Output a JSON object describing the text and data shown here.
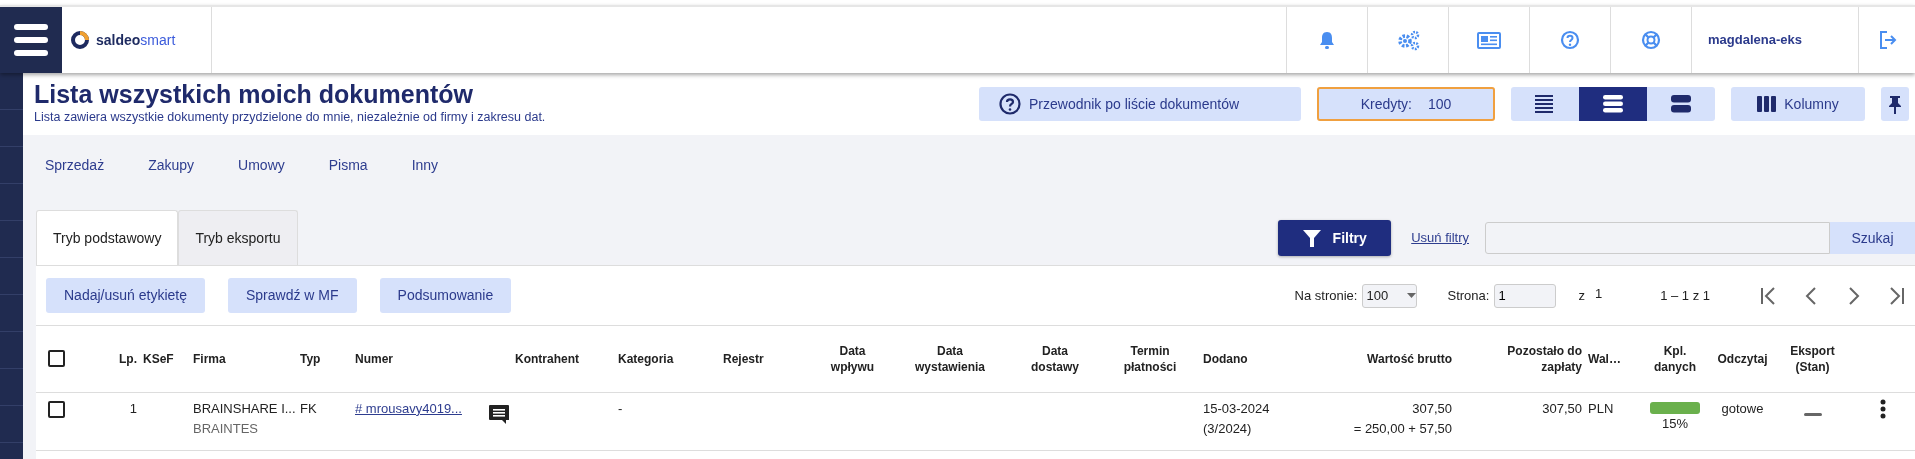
{
  "header": {
    "logo": {
      "part_a": "saldeo",
      "part_b": "smart"
    },
    "username": "magdalena-eks"
  },
  "page": {
    "title": "Lista wszystkich moich dokumentów",
    "subtitle": "Lista zawiera wszystkie dokumenty przydzielone do mnie, niezależnie od firmy i zakresu dat."
  },
  "toolbar": {
    "guide_button": "Przewodnik po liście dokumentów",
    "credits": {
      "label": "Kredyty:",
      "value": "100"
    },
    "view_modes": [
      {
        "kind": "compact",
        "selected": false
      },
      {
        "kind": "normal",
        "selected": true
      },
      {
        "kind": "wide",
        "selected": false
      }
    ],
    "columns_button": "Kolumny"
  },
  "categories": [
    "Sprzedaż",
    "Zakupy",
    "Umowy",
    "Pisma",
    "Inny"
  ],
  "tabs": [
    {
      "label": "Tryb podstawowy",
      "selected": true
    },
    {
      "label": "Tryb eksportu",
      "selected": false
    }
  ],
  "filters": {
    "filter_button": "Filtry",
    "clear_link": "Usuń filtry",
    "search_button": "Szukaj"
  },
  "actions": [
    "Nadaj/usuń etykietę",
    "Sprawdź w MF",
    "Podsumowanie"
  ],
  "pagination": {
    "per_page_label": "Na stronie:",
    "per_page": "100",
    "page_label": "Strona:",
    "page": "1",
    "of_label": "z",
    "total_pages": "1",
    "range": "1 – 1 z 1"
  },
  "table": {
    "select_all": {
      "checked": false
    },
    "columns": [
      {
        "lines": [
          "Lp."
        ]
      },
      {
        "lines": [
          "KSeF"
        ]
      },
      {
        "lines": [
          "Firma"
        ]
      },
      {
        "lines": [
          "Typ"
        ]
      },
      {
        "lines": [
          "Numer"
        ]
      },
      {
        "lines": [
          "Kontrahent"
        ]
      },
      {
        "lines": [
          "Kategoria"
        ]
      },
      {
        "lines": [
          "Rejestr"
        ]
      },
      {
        "lines": [
          "Data",
          "wpływu"
        ]
      },
      {
        "lines": [
          "Data",
          "wystawienia"
        ]
      },
      {
        "lines": [
          "Data",
          "dostawy"
        ]
      },
      {
        "lines": [
          "Termin",
          "płatności"
        ]
      },
      {
        "lines": [
          "Dodano"
        ]
      },
      {
        "lines": [
          "Wartość brutto"
        ]
      },
      {
        "lines": [
          "Pozostało do",
          "zapłaty"
        ]
      },
      {
        "lines": [
          "Wal…"
        ]
      },
      {
        "lines": [
          "Kpl.",
          "danych"
        ]
      },
      {
        "lines": [
          "Odczytaj"
        ]
      },
      {
        "lines": [
          "Eksport",
          "(Stan)"
        ]
      }
    ],
    "rows": [
      {
        "checked": false,
        "lp": "1",
        "firma": "BRAINSHARE I...",
        "firma_sub": "BRAINTES",
        "typ": "FK",
        "numer": "# mrousavy4019...",
        "has_comment": true,
        "kategoria": "-",
        "dodano": "15-03-2024",
        "dodano_sub": "(3/2024)",
        "brutto": "307,50",
        "brutto_sub": "= 250,00 + 57,50",
        "pozostalo": "307,50",
        "waluta": "PLN",
        "completeness": {
          "level": 1,
          "reading": "15%"
        },
        "odczytaj": "gotowe",
        "export_pending": true
      }
    ]
  }
}
